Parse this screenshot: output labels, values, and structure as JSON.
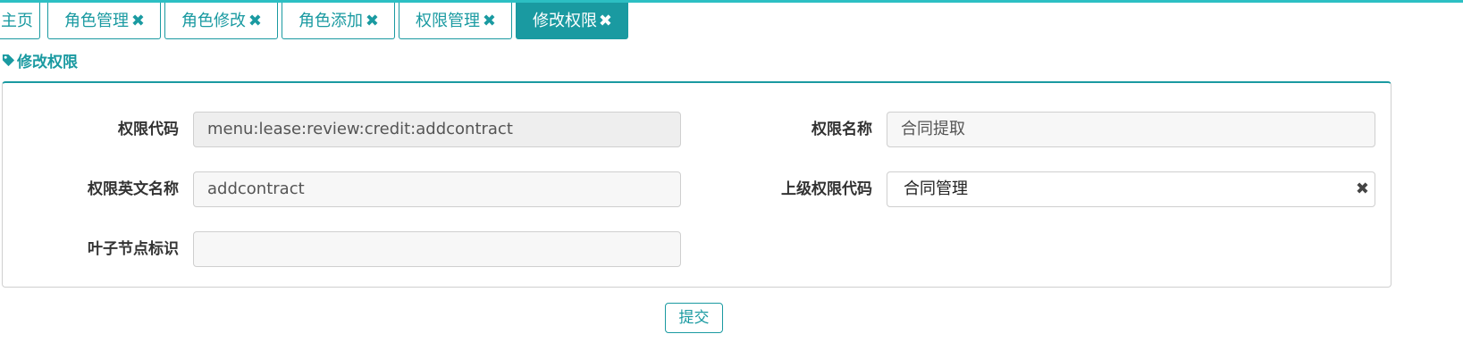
{
  "tabs": [
    {
      "label": "主页",
      "closable": false,
      "active": false
    },
    {
      "label": "角色管理",
      "closable": true,
      "active": false
    },
    {
      "label": "角色修改",
      "closable": true,
      "active": false
    },
    {
      "label": "角色添加",
      "closable": true,
      "active": false
    },
    {
      "label": "权限管理",
      "closable": true,
      "active": false
    },
    {
      "label": "修改权限",
      "closable": true,
      "active": true
    }
  ],
  "tab_close_glyph": "✖",
  "section": {
    "title": "修改权限",
    "icon": "tag-icon"
  },
  "form": {
    "perm_code": {
      "label": "权限代码",
      "value": "menu:lease:review:credit:addcontract"
    },
    "perm_name": {
      "label": "权限名称",
      "value": "合同提取"
    },
    "perm_en_name": {
      "label": "权限英文名称",
      "value": "addcontract"
    },
    "parent_code": {
      "label": "上级权限代码",
      "value": "合同管理",
      "clear_glyph": "✖"
    },
    "leaf_flag": {
      "label": "叶子节点标识",
      "value": ""
    }
  },
  "submit_label": "提交",
  "colors": {
    "accent": "#1a9aa1",
    "topline": "#2cbfc3"
  }
}
